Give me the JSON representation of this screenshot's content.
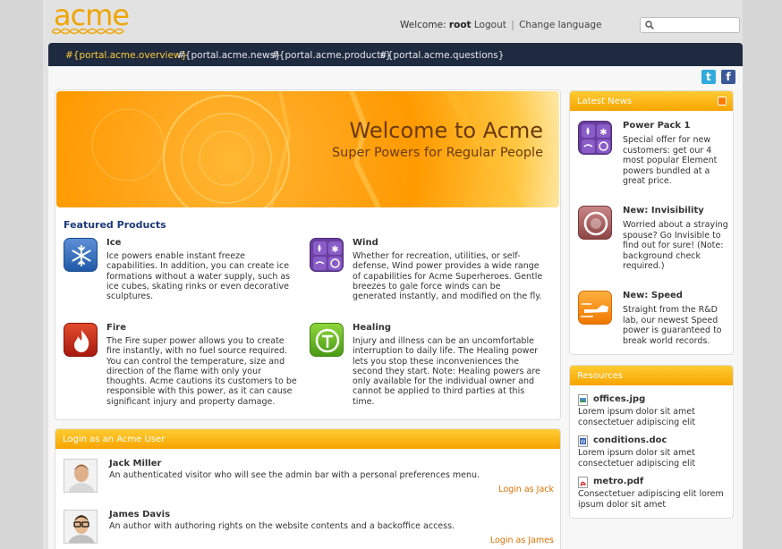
{
  "header": {
    "logo_text": "acme",
    "welcome_label": "Welcome:",
    "username": "root",
    "logout_label": "Logout",
    "separator": "|",
    "change_language_label": "Change language",
    "search_placeholder": ""
  },
  "nav": {
    "items": [
      {
        "label": "#{portal.acme.overview}",
        "active": true
      },
      {
        "label": "#{portal.acme.news}",
        "active": false
      },
      {
        "label": "#{portal.acme.products}",
        "active": false
      },
      {
        "label": "#{portal.acme.questions}",
        "active": false
      }
    ]
  },
  "social": {
    "twitter_glyph": "t",
    "facebook_glyph": "f"
  },
  "banner": {
    "title": "Welcome to Acme",
    "subtitle": "Super Powers for Regular People"
  },
  "featured": {
    "title": "Featured Products",
    "products": [
      {
        "name": "Ice",
        "icon": "snowflake-icon",
        "desc": "Ice powers enable instant freeze capabilities. In addition, you can create ice formations without a water supply, such as ice cubes, skating rinks or even decorative sculptures."
      },
      {
        "name": "Wind",
        "icon": "element-icon",
        "desc": "Whether for recreation, utilities, or self-defense, Wind power provides a wide range of capabilities for Acme Superheroes. Gentle breezes to gale force winds can be generated instantly, and modified on the fly."
      },
      {
        "name": "Fire",
        "icon": "flame-icon",
        "desc": "The Fire super power allows you to create fire instantly, with no fuel source required. You can control the temperature, size and direction of the flame with only your thoughts. Acme cautions its customers to be responsible with this power, as it can cause significant injury and property damage."
      },
      {
        "name": "Healing",
        "icon": "healing-icon",
        "desc": "Injury and illness can be an uncomfortable interruption to daily life. The Healing power lets you stop these inconveniences the second they start. Note: Healing powers are only available for the individual owner and cannot be applied to third parties at this time."
      }
    ]
  },
  "login": {
    "title": "Login as an Acme User",
    "users": [
      {
        "name": "Jack Miller",
        "desc": "An authenticated visitor who will see the admin bar with a personal preferences menu.",
        "link": "Login as Jack"
      },
      {
        "name": "James Davis",
        "desc": "An author with authoring rights on the website contents and a backoffice access.",
        "link": "Login as James"
      }
    ]
  },
  "news": {
    "title": "Latest News",
    "items": [
      {
        "title": "Power Pack 1",
        "icon": "element-icon",
        "desc": "Special offer for new customers: get our 4 most popular Element powers bundled at a great price."
      },
      {
        "title": "New: Invisibility",
        "icon": "invisibility-icon",
        "desc": "Worried about a straying spouse? Go Invisible to find out for sure! (Note: background check required.)"
      },
      {
        "title": "New: Speed",
        "icon": "speed-icon",
        "desc": "Straight from the R&D lab, our newest Speed power is guaranteed to break world records."
      }
    ]
  },
  "resources": {
    "title": "Resources",
    "items": [
      {
        "name": "offices.jpg",
        "type": "image",
        "desc": "Lorem ipsum dolor sit amet consectetuer adipiscing elit"
      },
      {
        "name": "conditions.doc",
        "type": "doc",
        "desc": "Lorem ipsum dolor sit amet consectetuer adipiscing elit"
      },
      {
        "name": "metro.pdf",
        "type": "pdf",
        "desc": "Consectetuer adipiscing elit lorem ipsum dolor sit amet"
      }
    ]
  },
  "colors": {
    "accent": "#f7a400",
    "nav_bg": "#1e2a40",
    "nav_active": "#ffcc33",
    "link": "#e07000",
    "heading": "#1e3a7a"
  }
}
